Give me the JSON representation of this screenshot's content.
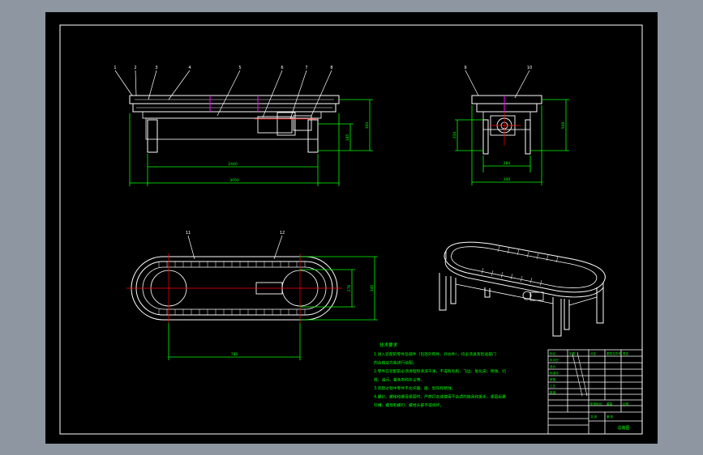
{
  "window": {
    "background": "#8e96a2"
  },
  "colors": {
    "paper": "#000000",
    "outline": "#ffffff",
    "dimension": "#00ff00",
    "centerline": "#ff0000",
    "leader": "#ffffff",
    "notes": "#00ff00",
    "accent": "#ff00ff"
  },
  "front_view": {
    "balloons": [
      "1",
      "2",
      "3",
      "4",
      "5",
      "6",
      "7",
      "8"
    ],
    "dims": {
      "overall_length": "3050",
      "leg_span": "2440",
      "height": "300",
      "height_inner": "185"
    }
  },
  "side_view": {
    "balloons": [
      "9",
      "10"
    ],
    "dims": {
      "width_outer": "340",
      "width_inner": "284",
      "height": "508",
      "height_left": "334"
    }
  },
  "top_view": {
    "balloons": [
      "11",
      "12"
    ],
    "dims": {
      "length": "780",
      "width": "276",
      "width_outer": "340"
    }
  },
  "notes": {
    "title": "技术要求",
    "lines": [
      "1.进入装配的零件及部件（包括外购件、外协件），均必须具有检验部门",
      "的合格证方能进行装配。",
      "2.零件在装配前必须清理和清洗干净，不得有毛刺、飞边、氧化皮、锈蚀、切",
      "屑、油污、着色剂和灰尘等。",
      "3.装配过程中零件不允许磕、碰、划伤和锈蚀。",
      "4.螺钉、螺栓和螺母紧固时，严禁打击或使用不合适的旋具和扳手，紧固后螺",
      "钉槽、螺母和螺钉、螺栓头部不得损坏。"
    ]
  },
  "title_block": {
    "cells": [
      "标记",
      "处数",
      "分区",
      "更改文件号",
      "签名",
      "年月日",
      "设计",
      "标准化",
      "审核",
      "工艺",
      "批准",
      "阶段标记",
      "重量",
      "比例",
      "共 张",
      "第 张"
    ],
    "drawing_no": "总装图"
  }
}
